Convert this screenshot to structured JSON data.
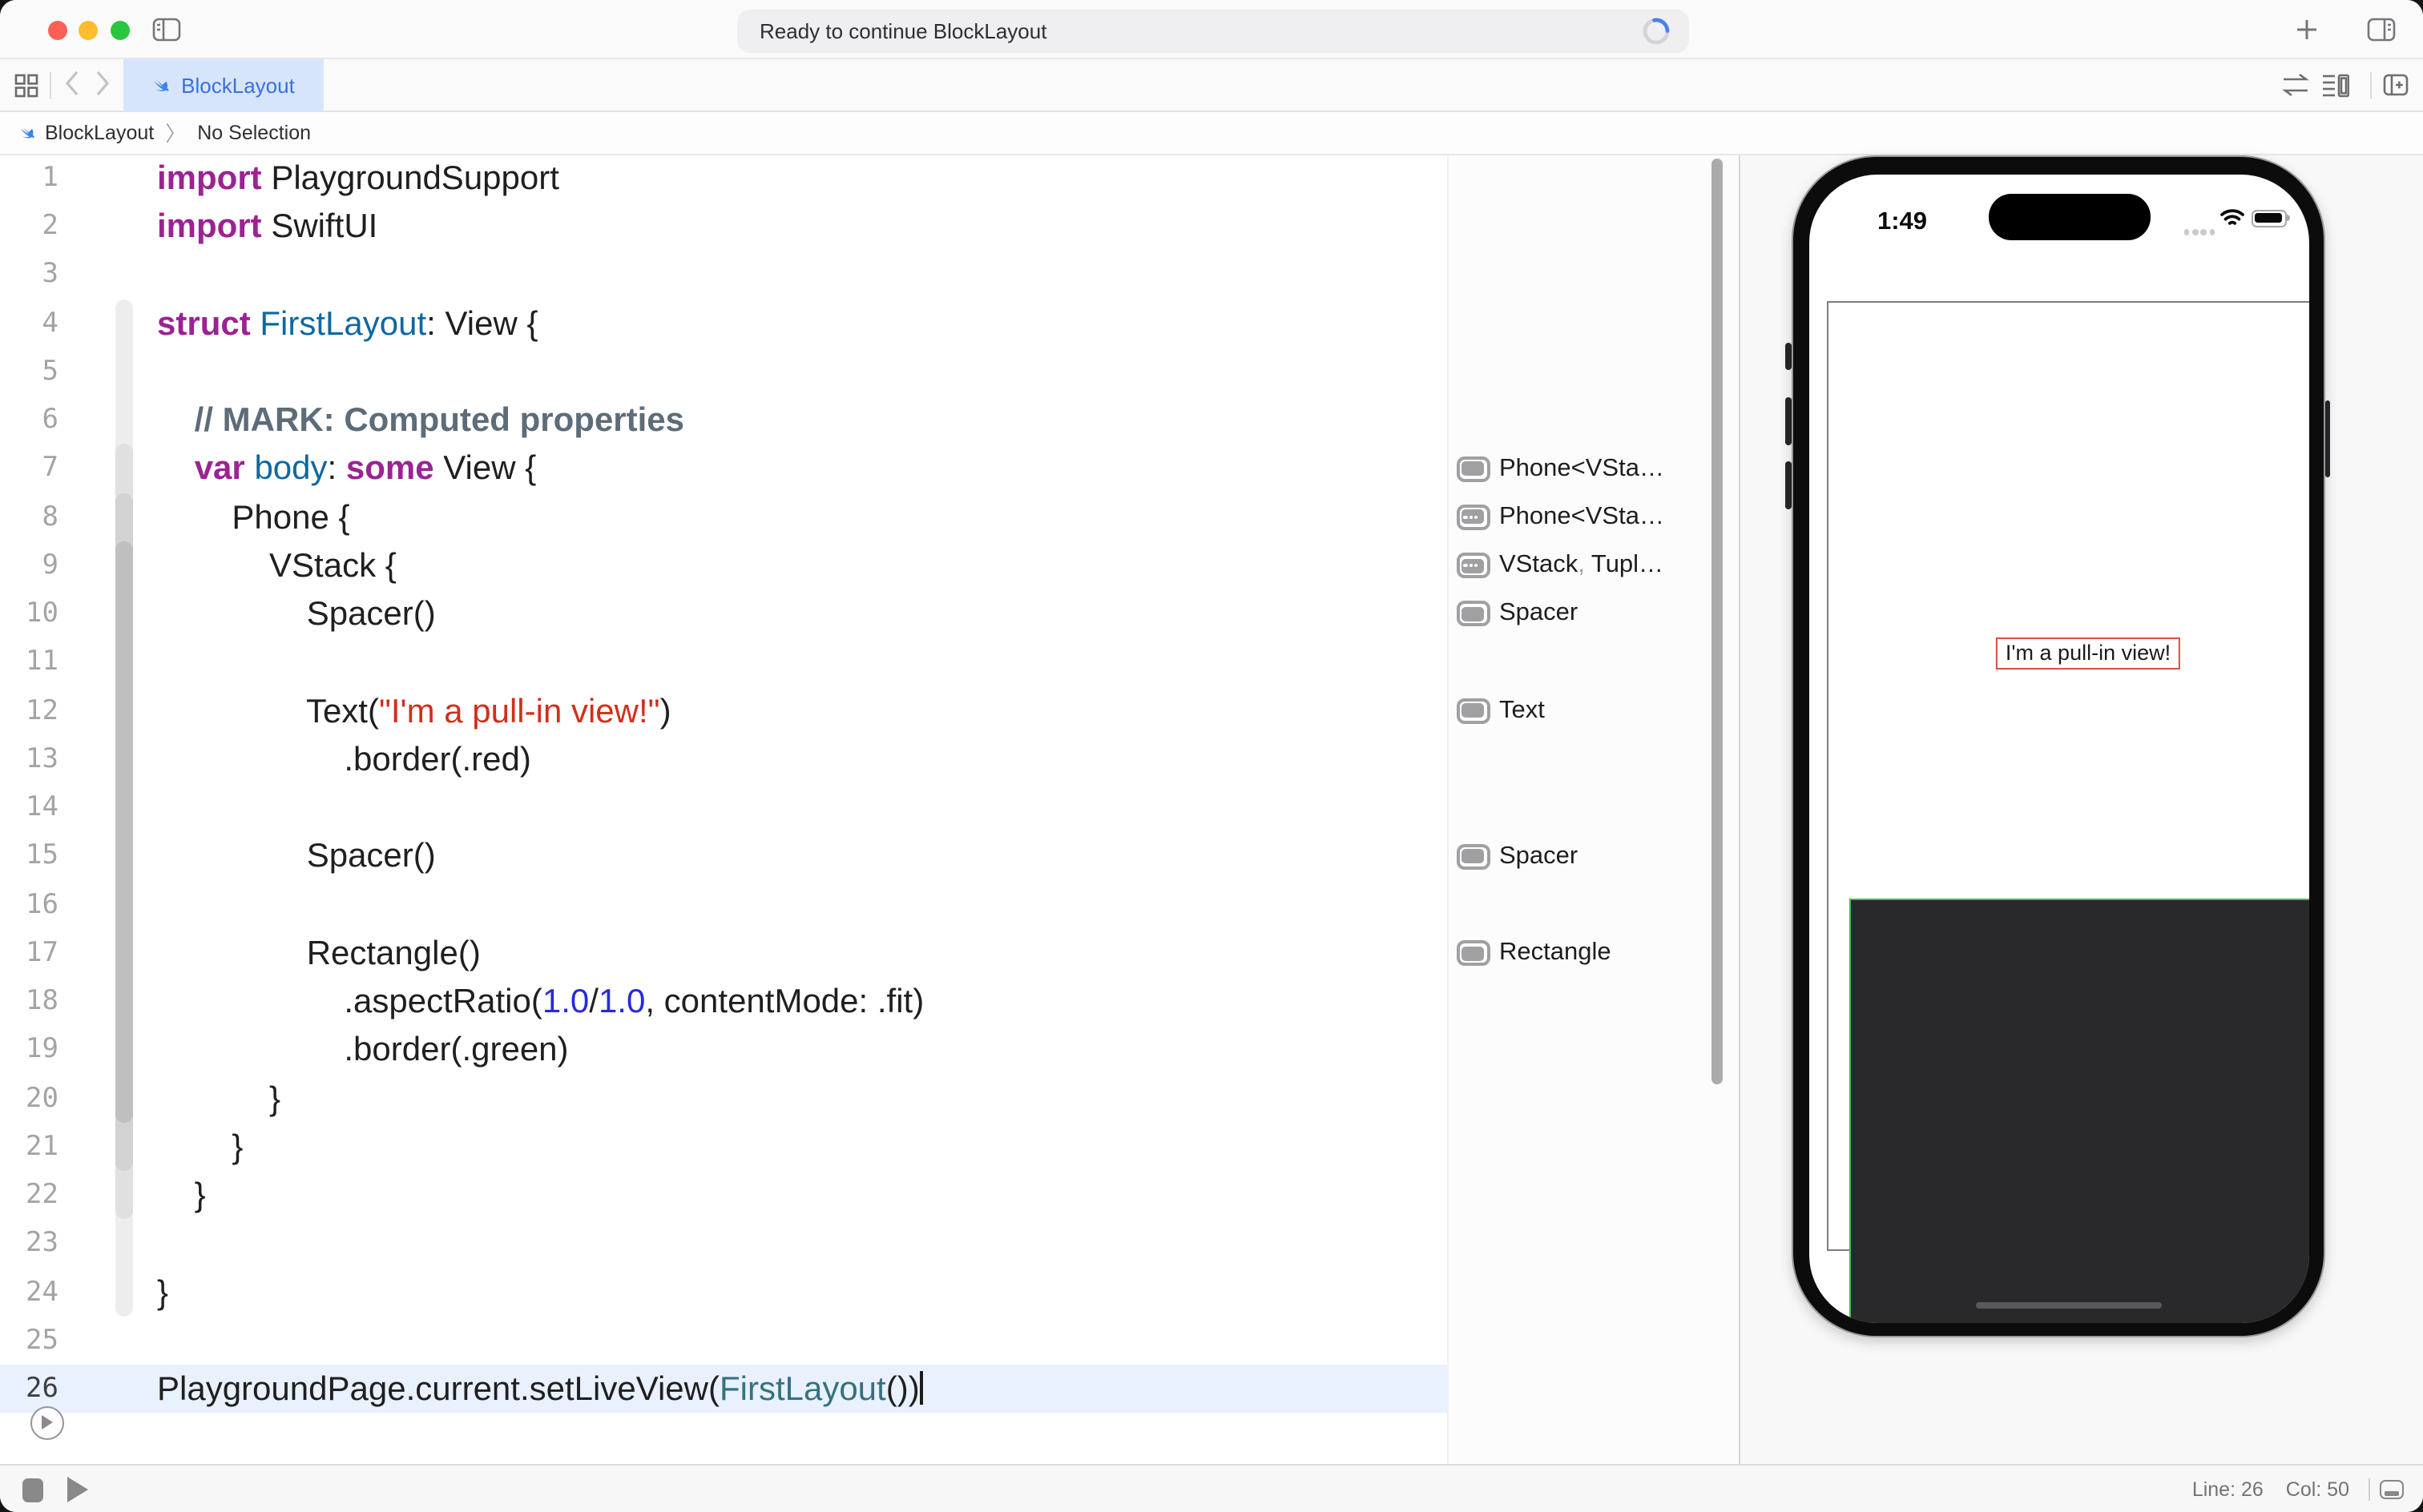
{
  "window": {
    "status_text": "Ready to continue BlockLayout"
  },
  "tab_bar": {
    "tab_label": "BlockLayout"
  },
  "jump_bar": {
    "file": "BlockLayout",
    "separator": "〉",
    "selection": "No Selection"
  },
  "editor": {
    "current_line": 26,
    "lines": [
      {
        "n": 1,
        "seg": [
          [
            "kw",
            "import"
          ],
          [
            "pl",
            " PlaygroundSupport"
          ]
        ]
      },
      {
        "n": 2,
        "seg": [
          [
            "kw",
            "import"
          ],
          [
            "pl",
            " SwiftUI"
          ]
        ]
      },
      {
        "n": 3,
        "seg": []
      },
      {
        "n": 4,
        "seg": [
          [
            "kw",
            "struct"
          ],
          [
            "pl",
            " "
          ],
          [
            "dc",
            "FirstLayout"
          ],
          [
            "pl",
            ": View {"
          ]
        ]
      },
      {
        "n": 5,
        "seg": []
      },
      {
        "n": 6,
        "seg": [
          [
            "cm",
            "    // MARK: Computed properties"
          ]
        ]
      },
      {
        "n": 7,
        "seg": [
          [
            "pl",
            "    "
          ],
          [
            "kw",
            "var"
          ],
          [
            "pl",
            " "
          ],
          [
            "dc",
            "body"
          ],
          [
            "pl",
            ": "
          ],
          [
            "kw",
            "some"
          ],
          [
            "pl",
            " View {"
          ]
        ]
      },
      {
        "n": 8,
        "seg": [
          [
            "pl",
            "        Phone {"
          ]
        ]
      },
      {
        "n": 9,
        "seg": [
          [
            "pl",
            "            VStack {"
          ]
        ]
      },
      {
        "n": 10,
        "seg": [
          [
            "pl",
            "                Spacer()"
          ]
        ]
      },
      {
        "n": 11,
        "seg": []
      },
      {
        "n": 12,
        "seg": [
          [
            "pl",
            "                Text("
          ],
          [
            "st",
            "\"I'm a pull-in view!\""
          ],
          [
            "pl",
            ")"
          ]
        ]
      },
      {
        "n": 13,
        "seg": [
          [
            "pl",
            "                    .border(.red)"
          ]
        ]
      },
      {
        "n": 14,
        "seg": []
      },
      {
        "n": 15,
        "seg": [
          [
            "pl",
            "                Spacer()"
          ]
        ]
      },
      {
        "n": 16,
        "seg": []
      },
      {
        "n": 17,
        "seg": [
          [
            "pl",
            "                Rectangle()"
          ]
        ]
      },
      {
        "n": 18,
        "seg": [
          [
            "pl",
            "                    .aspectRatio("
          ],
          [
            "nu",
            "1.0"
          ],
          [
            "pl",
            "/"
          ],
          [
            "nu",
            "1.0"
          ],
          [
            "pl",
            ", contentMode: .fit)"
          ]
        ]
      },
      {
        "n": 19,
        "seg": [
          [
            "pl",
            "                    .border(.green)"
          ]
        ]
      },
      {
        "n": 20,
        "seg": [
          [
            "pl",
            "            }"
          ]
        ]
      },
      {
        "n": 21,
        "seg": [
          [
            "pl",
            "        }"
          ]
        ]
      },
      {
        "n": 22,
        "seg": [
          [
            "pl",
            "    }"
          ]
        ]
      },
      {
        "n": 23,
        "seg": []
      },
      {
        "n": 24,
        "seg": [
          [
            "pl",
            "}"
          ]
        ]
      },
      {
        "n": 25,
        "seg": []
      },
      {
        "n": 26,
        "seg": [
          [
            "pl",
            "PlaygroundPage.current.setLiveView("
          ],
          [
            "ty",
            "FirstLayout"
          ],
          [
            "pl",
            "())"
          ]
        ]
      }
    ],
    "scopes": [
      {
        "from": 4,
        "to": 24,
        "color": "#EDEDED"
      },
      {
        "from": 7,
        "to": 22,
        "color": "#E0E0E0"
      },
      {
        "from": 8,
        "to": 21,
        "color": "#D2D2D3"
      },
      {
        "from": 9,
        "to": 20,
        "color": "#BFBFC0"
      }
    ]
  },
  "annotations": {
    "items": [
      {
        "line": 7,
        "icon": "solid",
        "parts": [
          [
            "Phone<VSta…",
            "d"
          ]
        ]
      },
      {
        "line": 8,
        "icon": "dots",
        "parts": [
          [
            "Phone<VSta…",
            "d"
          ]
        ]
      },
      {
        "line": 9,
        "icon": "dots",
        "parts": [
          [
            "VStack",
            "d"
          ],
          [
            ", ",
            "g"
          ],
          [
            "Tupl…",
            "d"
          ]
        ]
      },
      {
        "line": 10,
        "icon": "solid",
        "parts": [
          [
            "Spacer",
            "d"
          ]
        ]
      },
      {
        "line": 12,
        "icon": "solid",
        "parts": [
          [
            "Text",
            "d"
          ]
        ]
      },
      {
        "line": 15,
        "icon": "solid",
        "parts": [
          [
            "Spacer",
            "d"
          ]
        ]
      },
      {
        "line": 17,
        "icon": "solid",
        "parts": [
          [
            "Rectangle",
            "d"
          ]
        ]
      }
    ]
  },
  "preview": {
    "time": "1:49",
    "pull_in_text": "I'm a pull-in view!"
  },
  "status_bar": {
    "line_label": "Line: 26",
    "col_label": "Col: 50"
  },
  "colors": {
    "accent_blue": "#3A6FDC",
    "tab_bg": "#D7E5FC",
    "string_red": "#D12F1B",
    "border_red": "#E14A41",
    "border_green": "#43BF47",
    "keyword_purple": "#9B2393"
  }
}
